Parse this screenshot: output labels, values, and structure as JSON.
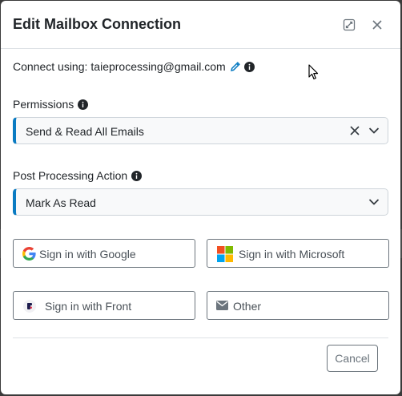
{
  "dialog": {
    "title": "Edit Mailbox Connection",
    "expand_icon": "expand-icon",
    "close_icon": "close-icon"
  },
  "connect": {
    "label": "Connect using:",
    "email": "taieprocessing@gmail.com",
    "edit_icon": "pencil-icon",
    "info_icon": "info-icon"
  },
  "permissions": {
    "label": "Permissions",
    "value": "Send & Read All Emails",
    "accent": "#0a7bc2"
  },
  "post_processing": {
    "label": "Post Processing Action",
    "value": "Mark As Read"
  },
  "sign_in": {
    "google": "Sign in with Google",
    "microsoft": "Sign in with Microsoft",
    "front": "Sign in with Front",
    "other": "Other"
  },
  "footer": {
    "cancel": "Cancel"
  }
}
